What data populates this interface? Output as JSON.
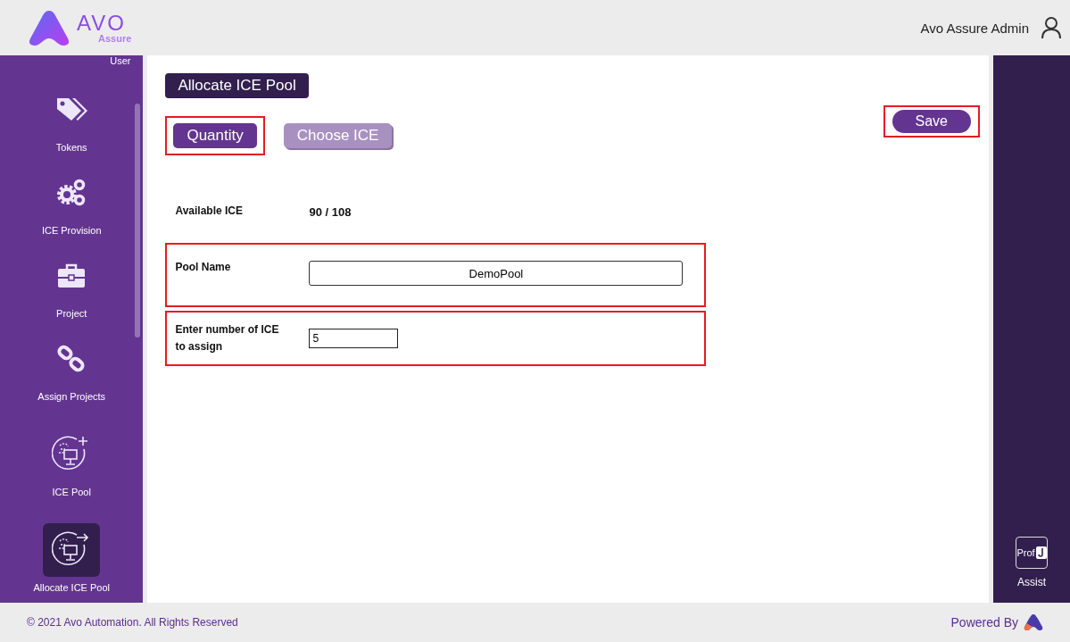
{
  "header": {
    "logo_mark": "AVO",
    "logo_sub": "Assure",
    "user_name": "Avo Assure Admin"
  },
  "sidebar": {
    "items": [
      {
        "label": "User",
        "kind": "user",
        "selected": false
      },
      {
        "label": "Tokens",
        "kind": "tokens",
        "selected": false
      },
      {
        "label": "ICE Provision",
        "kind": "gears",
        "selected": false
      },
      {
        "label": "Project",
        "kind": "briefcase",
        "selected": false
      },
      {
        "label": "Assign Projects",
        "kind": "link",
        "selected": false
      },
      {
        "label": "ICE Pool",
        "kind": "pool-add",
        "selected": false
      },
      {
        "label": "Allocate ICE Pool",
        "kind": "pool-allocate",
        "selected": true
      }
    ]
  },
  "page_title": "Allocate ICE Pool",
  "tabs": [
    {
      "label": "Quantity",
      "selected": true,
      "highlighted": true
    },
    {
      "label": "Choose ICE",
      "selected": false,
      "highlighted": false
    }
  ],
  "save_button": {
    "label": "Save",
    "highlighted": true
  },
  "form": [
    {
      "kind": "text",
      "label": "Available ICE",
      "value": "90 / 108",
      "highlighted": false
    },
    {
      "kind": "wide-input",
      "label": "Pool Name",
      "value": "DemoPool",
      "highlighted": true
    },
    {
      "kind": "small-input",
      "label": "Enter number of ICE to assign",
      "value": "5",
      "highlighted": true
    }
  ],
  "right_panel": {
    "badge": "Prof",
    "label": "Assist"
  },
  "footer": {
    "copyright": "© 2021 Avo Automation. All Rights Reserved",
    "powered_by": "Powered By"
  }
}
